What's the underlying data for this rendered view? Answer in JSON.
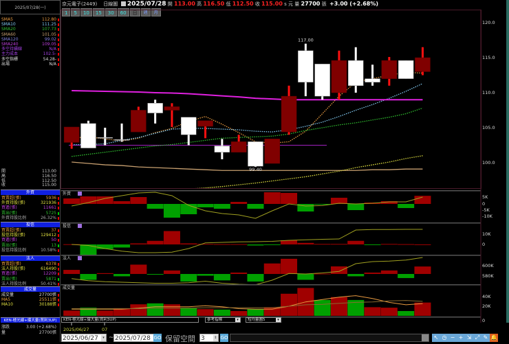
{
  "left": {
    "date": "2025/07/28(一)",
    "ma": [
      {
        "label": "SMA5",
        "value": "112.80",
        "color": "#e89a40"
      },
      {
        "label": "SMA10",
        "value": "111.25",
        "color": "#80c8f0"
      },
      {
        "label": "SMA20",
        "value": "107.73",
        "color": "#30c030"
      },
      {
        "label": "SMA60",
        "value": "101.05",
        "color": "#c8a070"
      },
      {
        "label": "SMA120",
        "value": "99.02",
        "color": "#8080e0"
      },
      {
        "label": "SMA240",
        "value": "109.05",
        "color": "#c040e0"
      },
      {
        "label": "多空持續線",
        "value": "N/A",
        "color": "#a040e0"
      },
      {
        "label": "主力成本",
        "value": "102.5-",
        "color": "#a040e0"
      },
      {
        "label": "多空指標",
        "value": "54.28-",
        "color": "#ddd"
      },
      {
        "label": "出場",
        "value": "N/A",
        "color": "#ddd"
      }
    ],
    "ohlc": [
      {
        "label": "開",
        "value": "113.00"
      },
      {
        "label": "高",
        "value": "116.50"
      },
      {
        "label": "低",
        "value": "112.50"
      },
      {
        "label": "收",
        "value": "115.00"
      }
    ],
    "sections": [
      {
        "title": "外資",
        "rows": [
          {
            "label": "買賣超(張)",
            "value": "5936",
            "color": "#e8a040"
          },
          {
            "label": "外資持股(張)",
            "value": "321936",
            "color": "#e0e040"
          },
          {
            "label": "買進(張)",
            "value": "11661",
            "color": "#c040e0"
          },
          {
            "label": "賣出(張)",
            "value": "5725",
            "color": "#30c030"
          },
          {
            "label": "外資持股比例",
            "value": "26.32%",
            "color": "#aaa"
          }
        ]
      },
      {
        "title": "投信",
        "rows": [
          {
            "label": "買賣超(張)",
            "value": "37",
            "color": "#e8a040"
          },
          {
            "label": "投信持股(張)",
            "value": "129412",
            "color": "#e0e040"
          },
          {
            "label": "買進(張)",
            "value": "50",
            "color": "#c040e0"
          },
          {
            "label": "賣出(張)",
            "value": "13",
            "color": "#30c030"
          },
          {
            "label": "投信持股比例",
            "value": "10.58%",
            "color": "#aaa"
          }
        ]
      },
      {
        "title": "法人",
        "rows": [
          {
            "label": "買賣超(張)",
            "value": "6378",
            "color": "#e8a040"
          },
          {
            "label": "法人持股(張)",
            "value": "616490",
            "color": "#e0e040"
          },
          {
            "label": "買進(張)",
            "value": "12209",
            "color": "#c040e0"
          },
          {
            "label": "賣出(張)",
            "value": "5871",
            "color": "#30c030"
          },
          {
            "label": "法人持股比例",
            "value": "50.41%",
            "color": "#aaa"
          }
        ]
      },
      {
        "title": "成交量",
        "rows": [
          {
            "label": "成交量",
            "value": "27700張",
            "color": "#ddd"
          },
          {
            "label": "MA5",
            "value": "25511張",
            "color": "#e8a040"
          },
          {
            "label": "MA10",
            "value": "30188張",
            "color": "#e0e040"
          }
        ]
      }
    ],
    "indicator": "KEN-極光線+爆大量(買利3UP)",
    "change_label": "漲跌",
    "change_value": "3.00 (+2.68%)",
    "volume_label": "量",
    "volume_value": "27700張"
  },
  "header": {
    "stock": "京元電子(2449)",
    "chart_type": "日線圖",
    "date": "2025/07/28",
    "open_label": "開",
    "open": "113.00",
    "high_label": "高",
    "high": "116.50",
    "low_label": "低",
    "low": "112.50",
    "close_label": "收",
    "close": "115.00",
    "unit": "s 元",
    "vol_label": "量",
    "volume": "27700",
    "vol_unit": "張",
    "change": "+3.00 (+2.68%)"
  },
  "periods": [
    "1",
    "5",
    "10",
    "15",
    "30",
    "60",
    "日",
    "週",
    "月"
  ],
  "chart_data": {
    "type": "candlestick",
    "price_axis": {
      "ticks": [
        "120.0",
        "115.0",
        "110.0",
        "105.0",
        "100.0"
      ],
      "range": [
        96.6,
        120.6
      ]
    },
    "candles": [
      [
        102.9,
        105.1,
        102,
        105.1
      ],
      [
        105.6,
        106,
        102.1,
        102.1
      ],
      [
        103.6,
        105,
        102.5,
        103.5
      ],
      [
        103.3,
        105.6,
        103,
        103.2
      ],
      [
        104.4,
        108,
        104.4,
        107.5
      ],
      [
        108.5,
        109,
        105.6,
        107.1
      ],
      [
        107.5,
        108.5,
        105.1,
        108
      ],
      [
        106.5,
        106.5,
        102.5,
        104
      ],
      [
        105.2,
        106,
        103.5,
        106
      ],
      [
        102.4,
        103.4,
        100.5,
        101.5
      ],
      [
        101.5,
        104,
        101.5,
        103
      ],
      [
        103,
        103,
        99.4,
        99.5
      ],
      [
        99.9,
        103.4,
        99.9,
        103.4
      ],
      [
        104.4,
        111,
        104,
        109.5
      ],
      [
        116,
        117,
        109.5,
        111.5
      ],
      [
        114.1,
        114.1,
        109,
        109.5
      ],
      [
        110,
        116,
        109,
        114.6
      ],
      [
        114.6,
        116.5,
        110,
        111
      ],
      [
        112,
        114,
        111,
        111.5
      ],
      [
        112,
        115.1,
        111,
        114.6
      ],
      [
        114.6,
        114.6,
        112,
        112
      ],
      [
        113,
        116.5,
        112.5,
        115
      ]
    ],
    "annotations": [
      {
        "text": "117.00",
        "bar": 14,
        "price": 117
      },
      {
        "text": "99.40",
        "bar": 11,
        "price": 99.4
      }
    ],
    "ma": {
      "SMA5": [
        103.5,
        103.7,
        103.4,
        103.1,
        103.5,
        104.3,
        104.9,
        105.9,
        106.6,
        105.5,
        104.3,
        103,
        102.8,
        103,
        104.5,
        107,
        109.5,
        111.5,
        112,
        112.5,
        112.9,
        112.8
      ],
      "SMA10": [
        102.6,
        102.6,
        102.7,
        103.2,
        103.6,
        104.2,
        104.8,
        104.9,
        104.9,
        104.8,
        104.7,
        104.5,
        104.4,
        104.7,
        105.2,
        105.8,
        106.6,
        107.5,
        108.3,
        109.2,
        110.2,
        111.3
      ],
      "SMA20": [
        100.9,
        101.2,
        101.5,
        101.8,
        102.1,
        102.4,
        102.6,
        102.9,
        103.2,
        103.5,
        103.6,
        103.7,
        103.8,
        104.1,
        104.6,
        105,
        105.4,
        105.7,
        106.1,
        106.5,
        107,
        107.8
      ],
      "SMA60": [
        100.1,
        99.9,
        99.7,
        99.6,
        99.4,
        99.3,
        99.2,
        99.1,
        99,
        98.9,
        98.9,
        98.9,
        98.9,
        98.9,
        98.9,
        98.9,
        98.9,
        98.9,
        99,
        99,
        99.1,
        99.1
      ],
      "SMA120": [
        95.2,
        95.35,
        95.5,
        95.65,
        95.8,
        95.95,
        96.1,
        96.25,
        96.4,
        96.6,
        96.85,
        97.1,
        97.4,
        97.7,
        98,
        98.4,
        98.8,
        99.3,
        99.7,
        100.1,
        100.6,
        101
      ],
      "SMA240": [
        110.3,
        110.25,
        110.2,
        110.15,
        110.1,
        110,
        109.95,
        109.85,
        109.7,
        109.55,
        109.4,
        109.2,
        109.1,
        109,
        109,
        109,
        109,
        109,
        109,
        109,
        109,
        109
      ]
    },
    "level_line": 102.5,
    "panels": [
      {
        "title": "外資",
        "ticks": [
          "5K",
          "0",
          "-5K",
          "-10K"
        ],
        "bars": [
          4,
          5.5,
          5.5,
          2,
          5,
          -3.5,
          -10,
          -7.5,
          -2.5,
          -3.5,
          1.5,
          -3.5,
          8.5,
          8,
          -5.5,
          -0.5,
          4.5,
          -4.5,
          1,
          2,
          -3,
          5.9
        ],
        "line": [
          -1.5,
          1,
          4,
          6,
          8,
          8.5,
          6,
          -1,
          -5,
          -7,
          -8,
          -10.5,
          -5,
          0,
          -1.5,
          -1.2,
          0.5,
          0,
          0.5,
          1.5,
          1.5,
          5
        ]
      },
      {
        "title": "投信",
        "ticks": [
          "10K",
          "0"
        ],
        "bars": [
          0.2,
          -10,
          -4.5,
          -3,
          1,
          3.5,
          13,
          1,
          0.5,
          0.3,
          0.3,
          -1,
          -0.5,
          4,
          1.5,
          0.5,
          0.5,
          3.5,
          -0.5,
          0.5,
          0.3,
          0.04
        ],
        "line": [
          0,
          -1,
          -4,
          -6.5,
          -8,
          -8,
          -7.5,
          -4,
          1.5,
          2,
          2.5,
          2.7,
          3,
          4,
          4.5,
          5,
          5.3,
          14,
          14.5,
          14.5,
          14.7,
          14.7
        ]
      },
      {
        "title": "法人",
        "ticks": [
          "600K",
          "580K"
        ],
        "bars": [
          3.5,
          -5,
          0.7,
          -2,
          8,
          -0.3,
          3,
          -6.5,
          -1.5,
          -5.5,
          1.2,
          -6.5,
          9,
          13,
          -5,
          0.3,
          6.5,
          -2,
          1.2,
          3,
          -3.5,
          6.4
        ],
        "line": [
          575,
          571,
          569,
          568,
          567,
          566,
          566,
          567,
          570,
          566,
          564,
          563,
          572,
          585,
          584,
          586,
          589,
          604,
          608,
          609,
          611,
          616
        ]
      },
      {
        "title": "成交量",
        "ticks": [
          "40K",
          "20K",
          "0"
        ],
        "bars": [
          11,
          17,
          11,
          16,
          24,
          26,
          24,
          17,
          14,
          13,
          10,
          14,
          18,
          46,
          58,
          33,
          39,
          33,
          18,
          17,
          10,
          27.7
        ],
        "up": [
          1,
          0,
          1,
          1,
          1,
          0,
          1,
          0,
          1,
          0,
          1,
          0,
          1,
          1,
          1,
          0,
          1,
          0,
          1,
          1,
          0,
          1
        ],
        "ma5": [
          14,
          14,
          14,
          14,
          16,
          19,
          19,
          19,
          21,
          19,
          15,
          14,
          14,
          20,
          29,
          34,
          39,
          42,
          36,
          28,
          23,
          25.5
        ],
        "ma10": [
          15,
          15,
          15,
          15,
          15,
          16,
          16,
          16,
          17,
          17,
          17,
          17,
          17,
          20,
          23,
          24,
          26,
          28,
          29,
          31,
          32,
          30.2
        ]
      }
    ],
    "x_labels": [
      "2025/06/27",
      "07"
    ],
    "colors": {
      "up_body": "#800000",
      "up_wick": "#ff1010",
      "down_body": "#ffffff",
      "pos_bar": "#a00000",
      "neg_bar": "#00a000"
    }
  },
  "toolbar": {
    "indicator_select": "KEN-極光線+爆大量(買利3UP)",
    "ref_select": "參考指標",
    "vol_select": "短均量圖5"
  },
  "controls": {
    "start_date": "2025/06/27",
    "tilde": "~",
    "end_date": "2025/07/28",
    "go": "GO",
    "reserve_label": "保留空間",
    "reserve_value": "3",
    "go2": "GO",
    "tools": [
      {
        "icon": "cursor-icon",
        "glyph": "↖"
      },
      {
        "icon": "clock-icon",
        "glyph": "◷"
      },
      {
        "icon": "zoom-out-icon",
        "glyph": "−"
      },
      {
        "icon": "zoom-in-icon",
        "glyph": "+"
      },
      {
        "icon": "resize-icon",
        "glyph": "⇲"
      },
      {
        "icon": "fit-icon",
        "glyph": "⤢"
      },
      {
        "icon": "draw-icon",
        "glyph": "✎"
      },
      {
        "icon": "alert-bell-icon",
        "glyph": "🔔"
      }
    ]
  }
}
